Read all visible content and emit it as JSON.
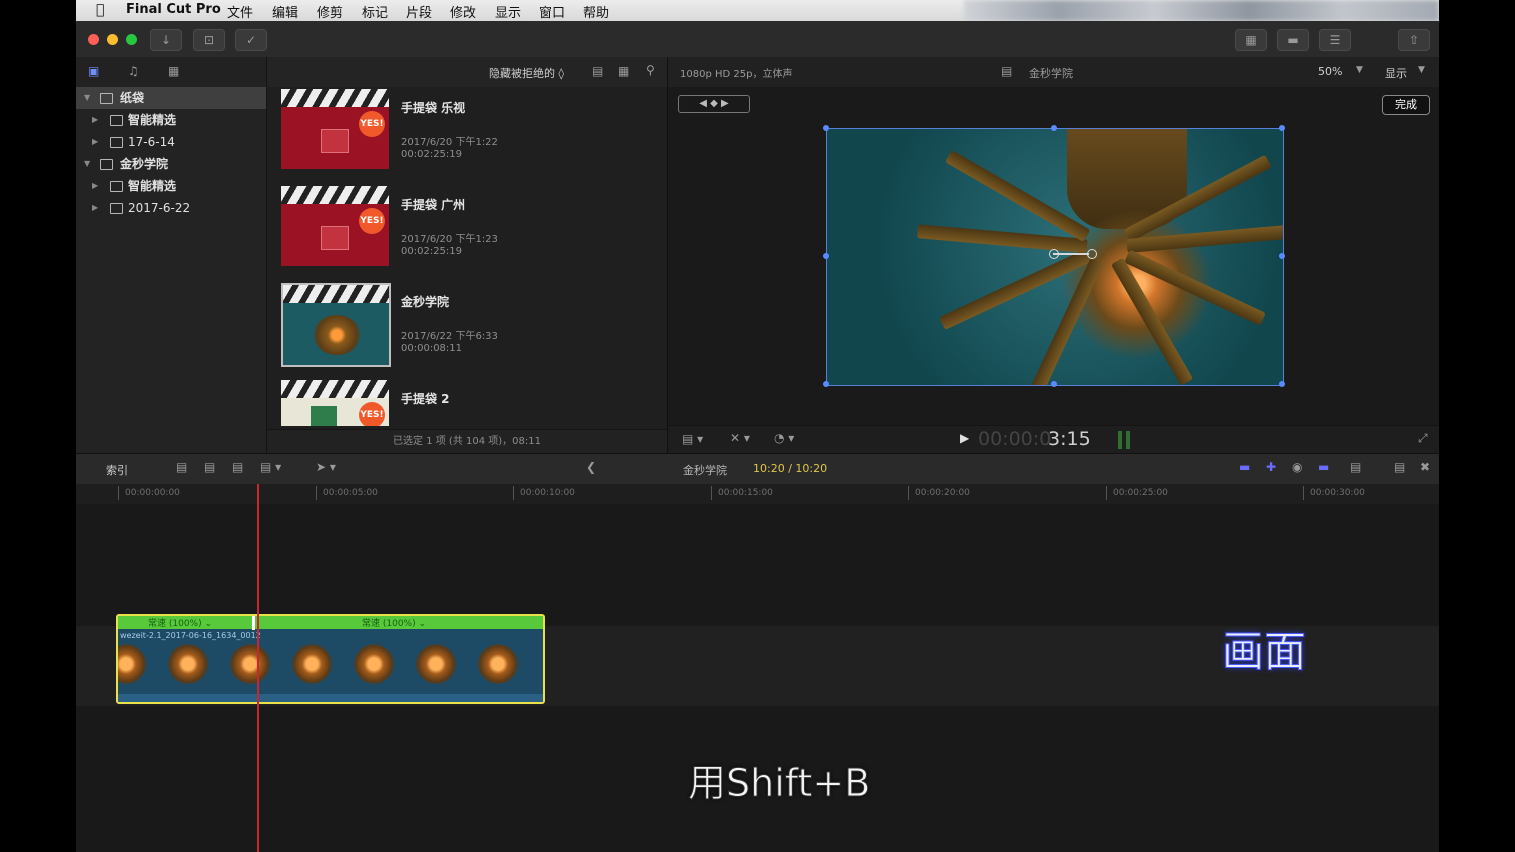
{
  "menubar": {
    "apple_icon": "apple-icon",
    "app_name": "Final Cut Pro",
    "items": [
      "文件",
      "编辑",
      "修剪",
      "标记",
      "片段",
      "修改",
      "显示",
      "窗口",
      "帮助"
    ]
  },
  "library": {
    "tree": [
      {
        "label": "纸袋",
        "icon": "library-icon",
        "level": 0,
        "expanded": true,
        "selected": true
      },
      {
        "label": "智能精选",
        "icon": "folder-icon",
        "level": 1
      },
      {
        "label": "17-6-14",
        "icon": "event-icon",
        "level": 1
      },
      {
        "label": "金秒学院",
        "icon": "library-icon",
        "level": 0,
        "expanded": true
      },
      {
        "label": "智能精选",
        "icon": "folder-icon",
        "level": 1
      },
      {
        "label": "2017-6-22",
        "icon": "event-icon",
        "level": 1
      }
    ]
  },
  "browser": {
    "filter_label": "隐藏被拒绝的 ◊",
    "clips": [
      {
        "name": "手提袋 乐视",
        "date": "2017/6/20 下午1:22",
        "duration": "00:02:25:19",
        "badge": "YES!",
        "kind": "red"
      },
      {
        "name": "手提袋 广州",
        "date": "2017/6/20 下午1:23",
        "duration": "00:02:25:19",
        "badge": "YES!",
        "kind": "red"
      },
      {
        "name": "金秒学院",
        "date": "2017/6/22 下午6:33",
        "duration": "00:00:08:11",
        "badge": "",
        "kind": "lamp"
      },
      {
        "name": "手提袋 2",
        "date": "",
        "duration": "",
        "badge": "YES!",
        "kind": "bag"
      }
    ],
    "status": "已选定 1 项 (共 104 项)，08:11"
  },
  "viewer": {
    "format": "1080p HD 25p，立体声",
    "project_name": "金秒学院",
    "zoom": "50%",
    "display_label": "显示",
    "done_label": "完成",
    "timecode_dim": "00:00:0",
    "timecode_bright": "3:15"
  },
  "timeline": {
    "index_label": "索引",
    "project_name": "金秒学院",
    "position": "10:20 / 10:20",
    "ruler": [
      "00:00:00:00",
      "00:00:05:00",
      "00:00:10:00",
      "00:00:15:00",
      "00:00:20:00",
      "00:00:25:00",
      "00:00:30:00"
    ],
    "clip": {
      "speed_left": "常速 (100%) ⌄",
      "speed_right": "常速 (100%) ⌄",
      "name": "wezeit-2.1_2017-06-16_1634_0012"
    }
  },
  "captions": {
    "right": "画面",
    "main": "用Shift+B"
  },
  "colors": {
    "accent_blue": "#5b8aff",
    "speed_green": "#58c93a",
    "selection_yellow": "#e8e14a",
    "playhead_red": "#c9272b"
  }
}
